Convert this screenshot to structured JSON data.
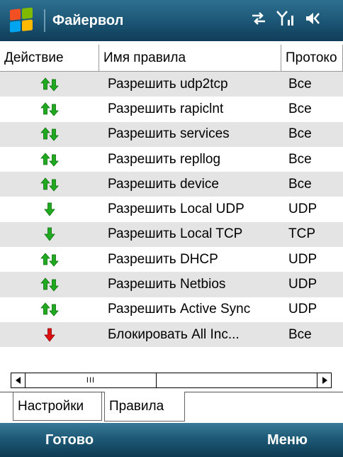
{
  "titlebar": {
    "app_title": "Файервол",
    "icons": [
      "windows-start-icon",
      "connectivity-icon",
      "signal-icon",
      "volume-icon"
    ]
  },
  "table": {
    "columns": [
      "Действие",
      "Имя правила",
      "Протоко"
    ],
    "rows": [
      {
        "action_icon": "allow-both-icon",
        "name": "Разрешить udp2tcp",
        "protocol": "Все"
      },
      {
        "action_icon": "allow-both-icon",
        "name": "Разрешить rapiclnt",
        "protocol": "Все"
      },
      {
        "action_icon": "allow-both-icon",
        "name": "Разрешить services",
        "protocol": "Все"
      },
      {
        "action_icon": "allow-both-icon",
        "name": "Разрешить repllog",
        "protocol": "Все"
      },
      {
        "action_icon": "allow-both-icon",
        "name": "Разрешить device",
        "protocol": "Все"
      },
      {
        "action_icon": "allow-in-icon",
        "name": "Разрешить Local UDP",
        "protocol": "UDP"
      },
      {
        "action_icon": "allow-in-icon",
        "name": "Разрешить Local TCP",
        "protocol": "TCP"
      },
      {
        "action_icon": "allow-both-icon",
        "name": "Разрешить DHCP",
        "protocol": "UDP"
      },
      {
        "action_icon": "allow-both-icon",
        "name": "Разрешить Netbios",
        "protocol": "UDP"
      },
      {
        "action_icon": "allow-both-icon",
        "name": "Разрешить Active Sync",
        "protocol": "UDP"
      },
      {
        "action_icon": "block-in-icon",
        "name": "Блокировать All Inc...",
        "protocol": "Все"
      }
    ]
  },
  "scrollbar": {
    "thumb_grip": "III"
  },
  "tabs": {
    "settings": "Настройки",
    "rules": "Правила",
    "active": "rules"
  },
  "softkeys": {
    "left": "Готово",
    "right": "Меню"
  },
  "colors": {
    "allow": "#1faa1f",
    "block": "#dd1111",
    "bar": "#1f5a7a",
    "row_alt": "#e4e4e4"
  }
}
